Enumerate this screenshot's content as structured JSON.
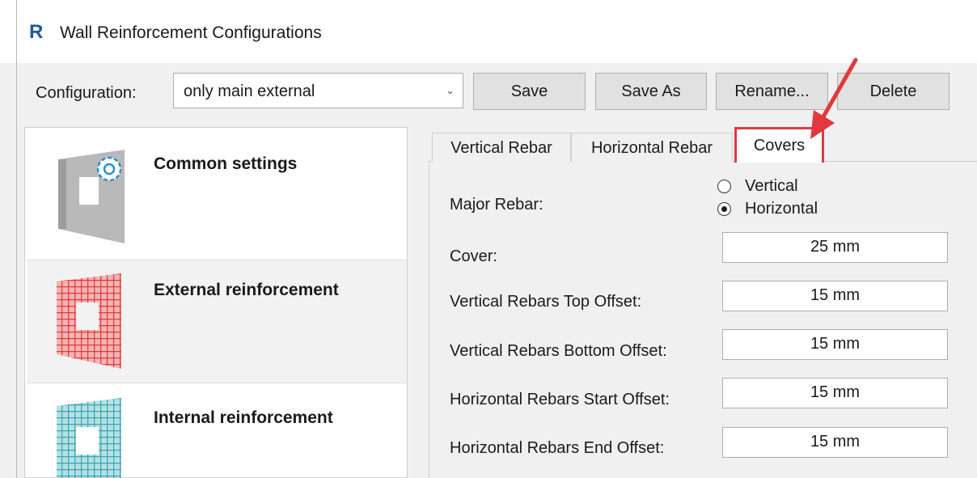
{
  "window": {
    "app_icon": "R",
    "title": "Wall Reinforcement Configurations"
  },
  "toolbar": {
    "configuration_label": "Configuration:",
    "configuration_value": "only main external",
    "chevron": "⌄",
    "save_label": "Save",
    "save_as_label": "Save As",
    "rename_label": "Rename...",
    "delete_label": "Delete"
  },
  "categories": [
    {
      "label": "Common settings",
      "icon": "wall-gear-icon"
    },
    {
      "label": "External reinforcement",
      "icon": "red-mesh-wall-icon"
    },
    {
      "label": "Internal reinforcement",
      "icon": "teal-mesh-wall-icon"
    }
  ],
  "tabs": [
    {
      "label": "Vertical Rebar"
    },
    {
      "label": "Horizontal Rebar"
    },
    {
      "label": "Covers",
      "selected": true
    }
  ],
  "covers": {
    "major_rebar_label": "Major Rebar:",
    "major_rebar_options": [
      {
        "label": "Vertical",
        "checked": false
      },
      {
        "label": "Horizontal",
        "checked": true
      }
    ],
    "fields": [
      {
        "label": "Cover:",
        "value": "25 mm"
      },
      {
        "label": "Vertical Rebars Top Offset:",
        "value": "15 mm"
      },
      {
        "label": "Vertical Rebars Bottom Offset:",
        "value": "15 mm"
      },
      {
        "label": "Horizontal Rebars Start Offset:",
        "value": "15 mm"
      },
      {
        "label": "Horizontal Rebars End Offset:",
        "value": "15 mm"
      }
    ]
  },
  "colors": {
    "annotation_red": "#e0393e",
    "external_mesh": "#e23b3b",
    "internal_mesh": "#3aa6b0",
    "app_icon_blue": "#1f57a6"
  }
}
